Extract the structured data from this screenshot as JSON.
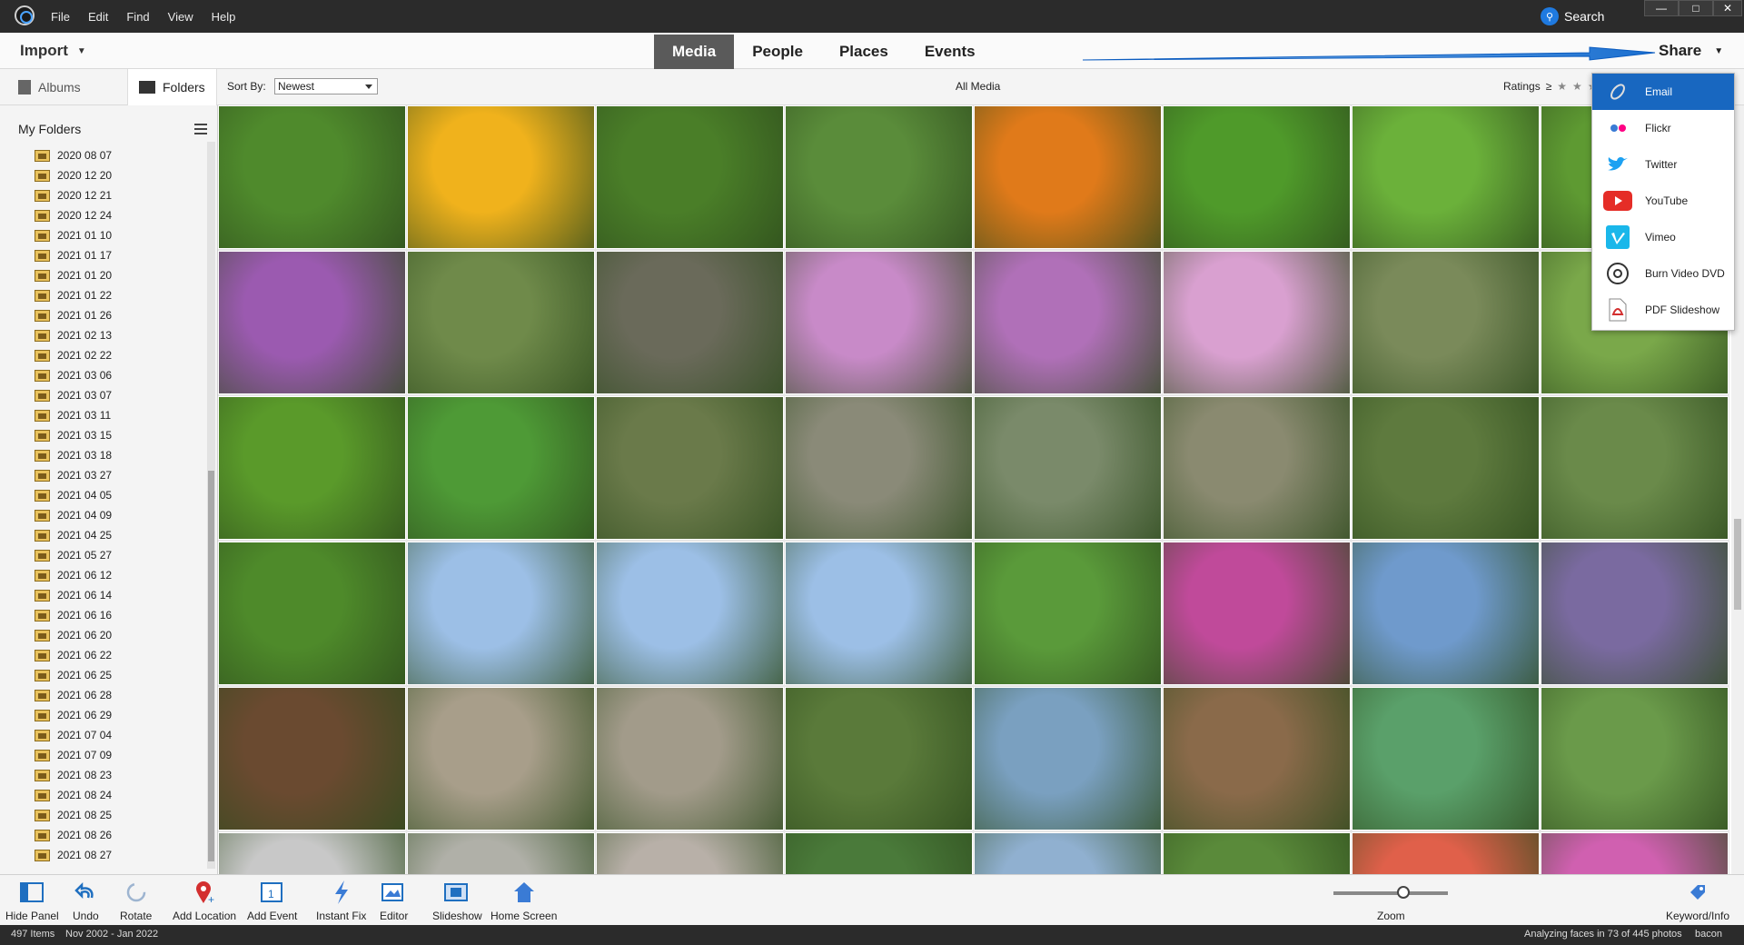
{
  "menu": [
    "File",
    "Edit",
    "Find",
    "View",
    "Help"
  ],
  "titlebar": {
    "search_label": "Search"
  },
  "nav": {
    "import_label": "Import",
    "tabs": [
      "Media",
      "People",
      "Places",
      "Events"
    ],
    "active_tab": "Media",
    "share_label": "Share"
  },
  "subbar": {
    "albums_label": "Albums",
    "folders_label": "Folders",
    "sort_label": "Sort By:",
    "sort_value": "Newest",
    "center_label": "All Media",
    "ratings_label": "Ratings"
  },
  "left_panel": {
    "title": "My Folders",
    "folders": [
      "2020 08 07",
      "2020 12 20",
      "2020 12 21",
      "2020 12 24",
      "2021 01 10",
      "2021 01 17",
      "2021 01 20",
      "2021 01 22",
      "2021 01 26",
      "2021 02 13",
      "2021 02 22",
      "2021 03 06",
      "2021 03 07",
      "2021 03 11",
      "2021 03 15",
      "2021 03 18",
      "2021 03 27",
      "2021 04 05",
      "2021 04 09",
      "2021 04 25",
      "2021 05 27",
      "2021 06 12",
      "2021 06 14",
      "2021 06 16",
      "2021 06 20",
      "2021 06 22",
      "2021 06 25",
      "2021 06 28",
      "2021 06 29",
      "2021 07 04",
      "2021 07 09",
      "2021 08 23",
      "2021 08 24",
      "2021 08 25",
      "2021 08 26",
      "2021 08 27"
    ]
  },
  "share_menu": {
    "items": [
      {
        "label": "Email",
        "icon": "email-icon"
      },
      {
        "label": "Flickr",
        "icon": "flickr-icon"
      },
      {
        "label": "Twitter",
        "icon": "twitter-icon"
      },
      {
        "label": "YouTube",
        "icon": "youtube-icon"
      },
      {
        "label": "Vimeo",
        "icon": "vimeo-icon"
      },
      {
        "label": "Burn Video DVD",
        "icon": "disc-icon"
      },
      {
        "label": "PDF Slideshow",
        "icon": "pdf-icon"
      }
    ],
    "active": "Email"
  },
  "bottom_tools": [
    {
      "label": "Hide Panel",
      "icon": "hide-panel-icon"
    },
    {
      "label": "Undo",
      "icon": "undo-icon"
    },
    {
      "label": "Rotate",
      "icon": "rotate-icon"
    },
    {
      "label": "Add Location",
      "icon": "location-pin-icon"
    },
    {
      "label": "Add Event",
      "icon": "calendar-icon"
    },
    {
      "label": "Instant Fix",
      "icon": "lightning-icon"
    },
    {
      "label": "Editor",
      "icon": "editor-icon"
    },
    {
      "label": "Slideshow",
      "icon": "slideshow-icon"
    },
    {
      "label": "Home Screen",
      "icon": "home-icon"
    }
  ],
  "zoom_label": "Zoom",
  "keyword_label": "Keyword/Info",
  "status": {
    "items_count": "497 Items",
    "date_range": "Nov 2002 - Jan 2022",
    "analysis": "Analyzing faces in 73 of 445 photos",
    "user": "bacon"
  },
  "thumbnails": [
    [
      "#4f8a2c",
      "#f0b21c",
      "#4a7e28",
      "#5a8c3a",
      "#e07a1a",
      "#4f9a2a",
      "#6bb13a",
      "#5e9a32"
    ],
    [
      "#9b5ab0",
      "#6f8a4a",
      "#6a6a5a",
      "#c88ac8",
      "#b070b8",
      "#d9a0d0",
      "#7a8a5a",
      "#7aa84a"
    ],
    [
      "#5a9a2a",
      "#4e9a36",
      "#6a7a4a",
      "#8a8a78",
      "#7a8a6a",
      "#8a8a70",
      "#5e7a3e",
      "#6a8a4a"
    ],
    [
      "#4e8a2a",
      "#9cbfe6",
      "#9cbfe6",
      "#9cbfe6",
      "#5a9a3a",
      "#c04a9a",
      "#6f9acc",
      "#7a6aa0"
    ],
    [
      "#6a4a30",
      "#a89e8a",
      "#a29b8a",
      "#5a7a3a",
      "#7aa0c0",
      "#8a6a4a",
      "#5aa06a",
      "#6a9a4a"
    ],
    [
      "#c8c8c8",
      "#b0b0a8",
      "#b8b0a8",
      "#4a7a3a",
      "#90b0d0",
      "#5a8a3a",
      "#e0604a",
      "#d060b0"
    ]
  ]
}
